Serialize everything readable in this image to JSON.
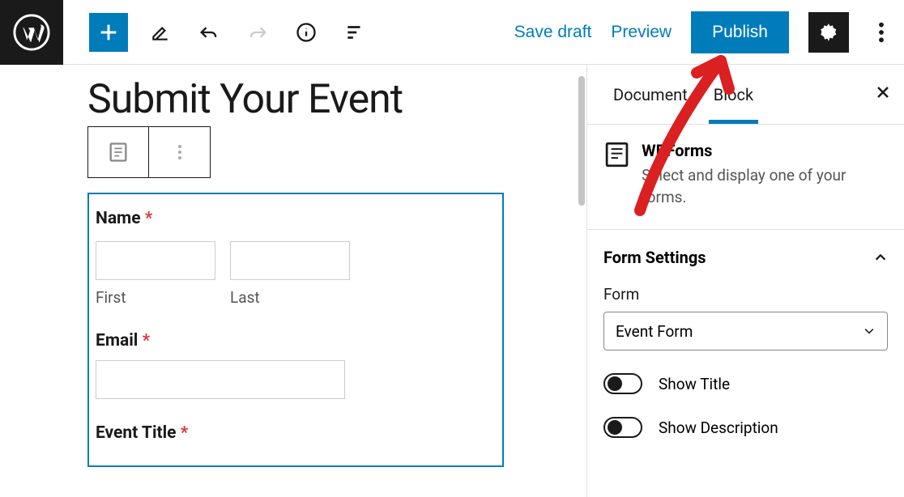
{
  "toolbar": {
    "save_draft": "Save draft",
    "preview": "Preview",
    "publish": "Publish"
  },
  "editor": {
    "page_title": "Submit Your Event",
    "form": {
      "name_label": "Name",
      "first_label": "First",
      "last_label": "Last",
      "email_label": "Email",
      "event_title_label": "Event Title",
      "required_marker": "*"
    }
  },
  "sidebar": {
    "tabs": {
      "document": "Document",
      "block": "Block"
    },
    "block_info": {
      "name": "WPForms",
      "description": "Select and display one of your forms."
    },
    "panel": {
      "title": "Form Settings",
      "form_label": "Form",
      "form_selected": "Event Form",
      "toggle_title": "Show Title",
      "toggle_description": "Show Description"
    }
  }
}
